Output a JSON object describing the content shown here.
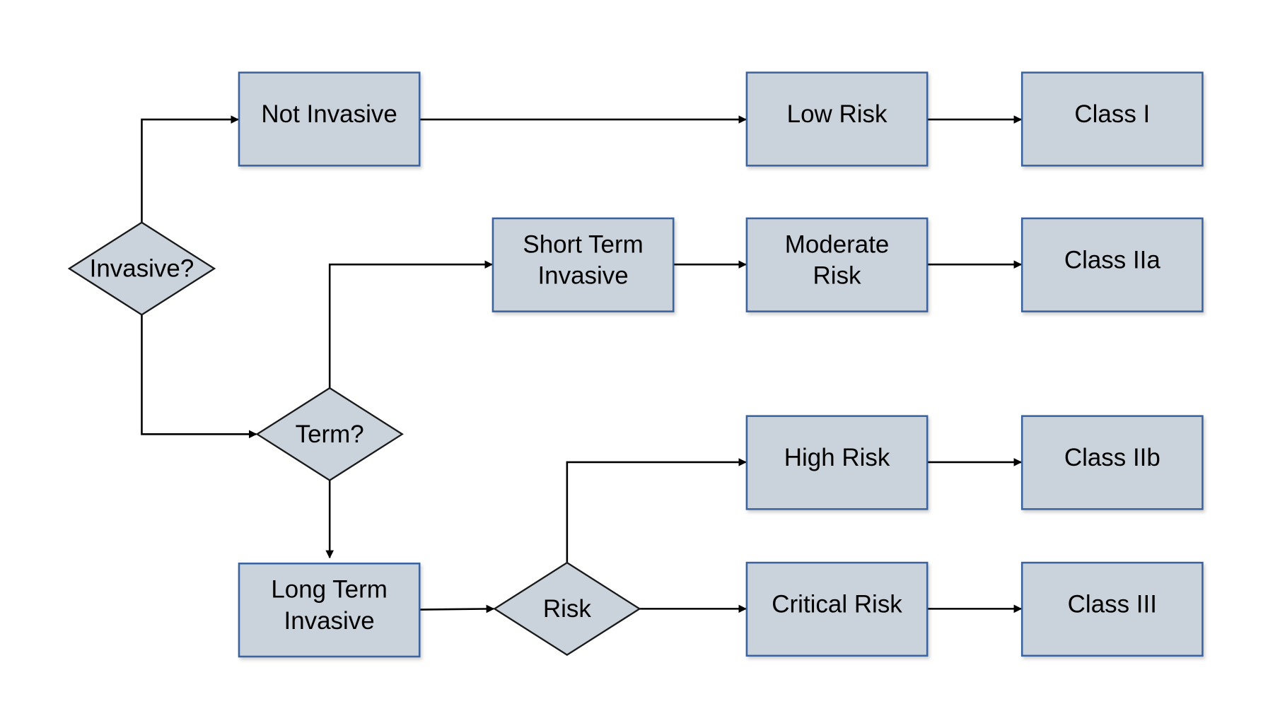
{
  "colors": {
    "node_fill": "#cad2dc",
    "node_border": "#3a64a0",
    "edge": "#000000"
  },
  "nodes": {
    "invasive": {
      "type": "decision",
      "lines": [
        "Invasive?"
      ]
    },
    "term": {
      "type": "decision",
      "lines": [
        "Term?"
      ]
    },
    "risk": {
      "type": "decision",
      "lines": [
        "Risk"
      ]
    },
    "not_invasive": {
      "type": "process",
      "lines": [
        "Not Invasive"
      ]
    },
    "short_term": {
      "type": "process",
      "lines": [
        "Short Term",
        "Invasive"
      ]
    },
    "long_term": {
      "type": "process",
      "lines": [
        "Long Term",
        "Invasive"
      ]
    },
    "low_risk": {
      "type": "process",
      "lines": [
        "Low Risk"
      ]
    },
    "moderate_risk": {
      "type": "process",
      "lines": [
        "Moderate",
        "Risk"
      ]
    },
    "high_risk": {
      "type": "process",
      "lines": [
        "High Risk"
      ]
    },
    "critical_risk": {
      "type": "process",
      "lines": [
        "Critical Risk"
      ]
    },
    "class_i": {
      "type": "process",
      "lines": [
        "Class I"
      ]
    },
    "class_iia": {
      "type": "process",
      "lines": [
        "Class IIa"
      ]
    },
    "class_iib": {
      "type": "process",
      "lines": [
        "Class IIb"
      ]
    },
    "class_iii": {
      "type": "process",
      "lines": [
        "Class III"
      ]
    }
  },
  "edges": [
    [
      "invasive",
      "not_invasive"
    ],
    [
      "invasive",
      "term"
    ],
    [
      "term",
      "short_term"
    ],
    [
      "term",
      "long_term"
    ],
    [
      "long_term",
      "risk"
    ],
    [
      "risk",
      "high_risk"
    ],
    [
      "risk",
      "critical_risk"
    ],
    [
      "not_invasive",
      "low_risk"
    ],
    [
      "short_term",
      "moderate_risk"
    ],
    [
      "low_risk",
      "class_i"
    ],
    [
      "moderate_risk",
      "class_iia"
    ],
    [
      "high_risk",
      "class_iib"
    ],
    [
      "critical_risk",
      "class_iii"
    ]
  ]
}
